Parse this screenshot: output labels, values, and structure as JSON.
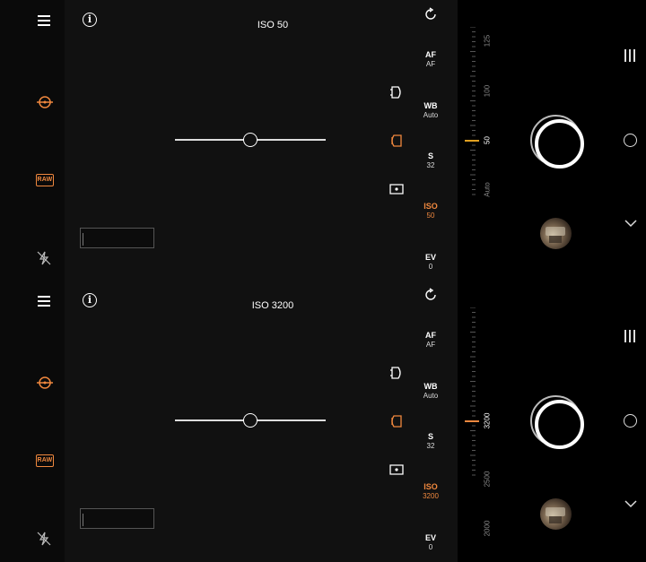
{
  "colors": {
    "accent": "#f0883e",
    "background": "#000000",
    "viewfinder": "#111111"
  },
  "icons": [
    "menu-icon",
    "info-icon",
    "focus-mode-icon",
    "raw-icon",
    "flash-off-icon",
    "rotate-icon",
    "lens-icon",
    "lens-front-icon",
    "panorama-icon",
    "more-icon",
    "mode-circle-icon",
    "chevron-down-icon"
  ],
  "raw_label": "RAW",
  "info_glyph": "i",
  "panels": [
    {
      "iso_indicator": "ISO 50",
      "settings": [
        {
          "name": "AF",
          "value": "AF"
        },
        {
          "name": "WB",
          "value": "Auto"
        },
        {
          "name": "S",
          "value": "32"
        },
        {
          "name": "ISO",
          "value": "50"
        },
        {
          "name": "EV",
          "value": "0"
        }
      ],
      "active_setting": "ISO",
      "dial_labels": [
        "125",
        "100",
        "50",
        "Auto"
      ],
      "dial_active": "50"
    },
    {
      "iso_indicator": "ISO 3200",
      "settings": [
        {
          "name": "AF",
          "value": "AF"
        },
        {
          "name": "WB",
          "value": "Auto"
        },
        {
          "name": "S",
          "value": "32"
        },
        {
          "name": "ISO",
          "value": "3200"
        },
        {
          "name": "EV",
          "value": "0"
        }
      ],
      "active_setting": "ISO",
      "dial_labels": [
        "3200",
        "2500",
        "2000"
      ],
      "dial_active": "3200"
    }
  ]
}
